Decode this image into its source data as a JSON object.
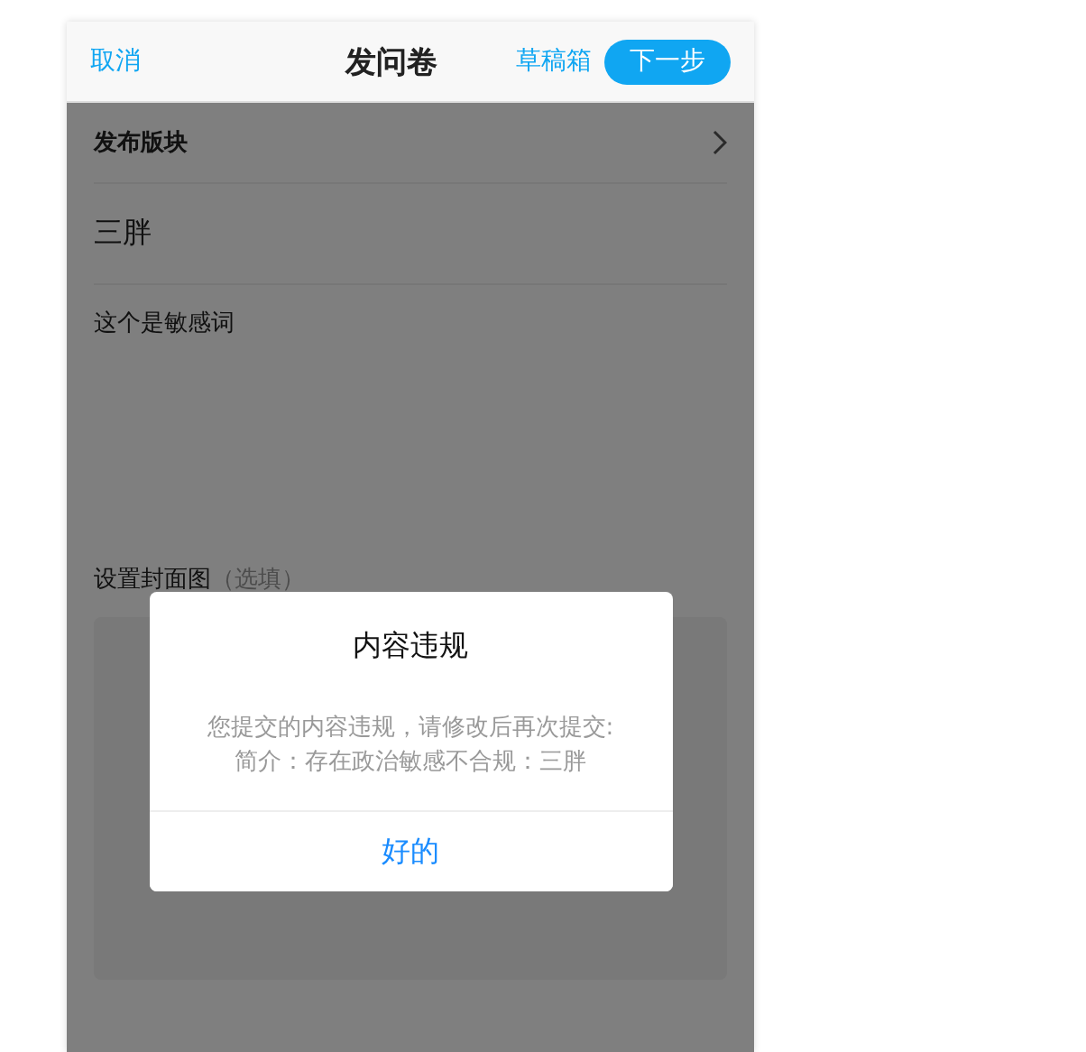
{
  "header": {
    "cancel": "取消",
    "title": "发问卷",
    "drafts": "草稿箱",
    "next": "下一步"
  },
  "form": {
    "section": {
      "label": "发布版块"
    },
    "title_value": "三胖",
    "description_value": "这个是敏感词",
    "cover": {
      "label": "设置封面图",
      "hint": "（选填）"
    }
  },
  "dialog": {
    "title": "内容违规",
    "message": "您提交的内容违规，请修改后再次提交:\n简介：存在政治敏感不合规：三胖",
    "confirm": "好的"
  }
}
